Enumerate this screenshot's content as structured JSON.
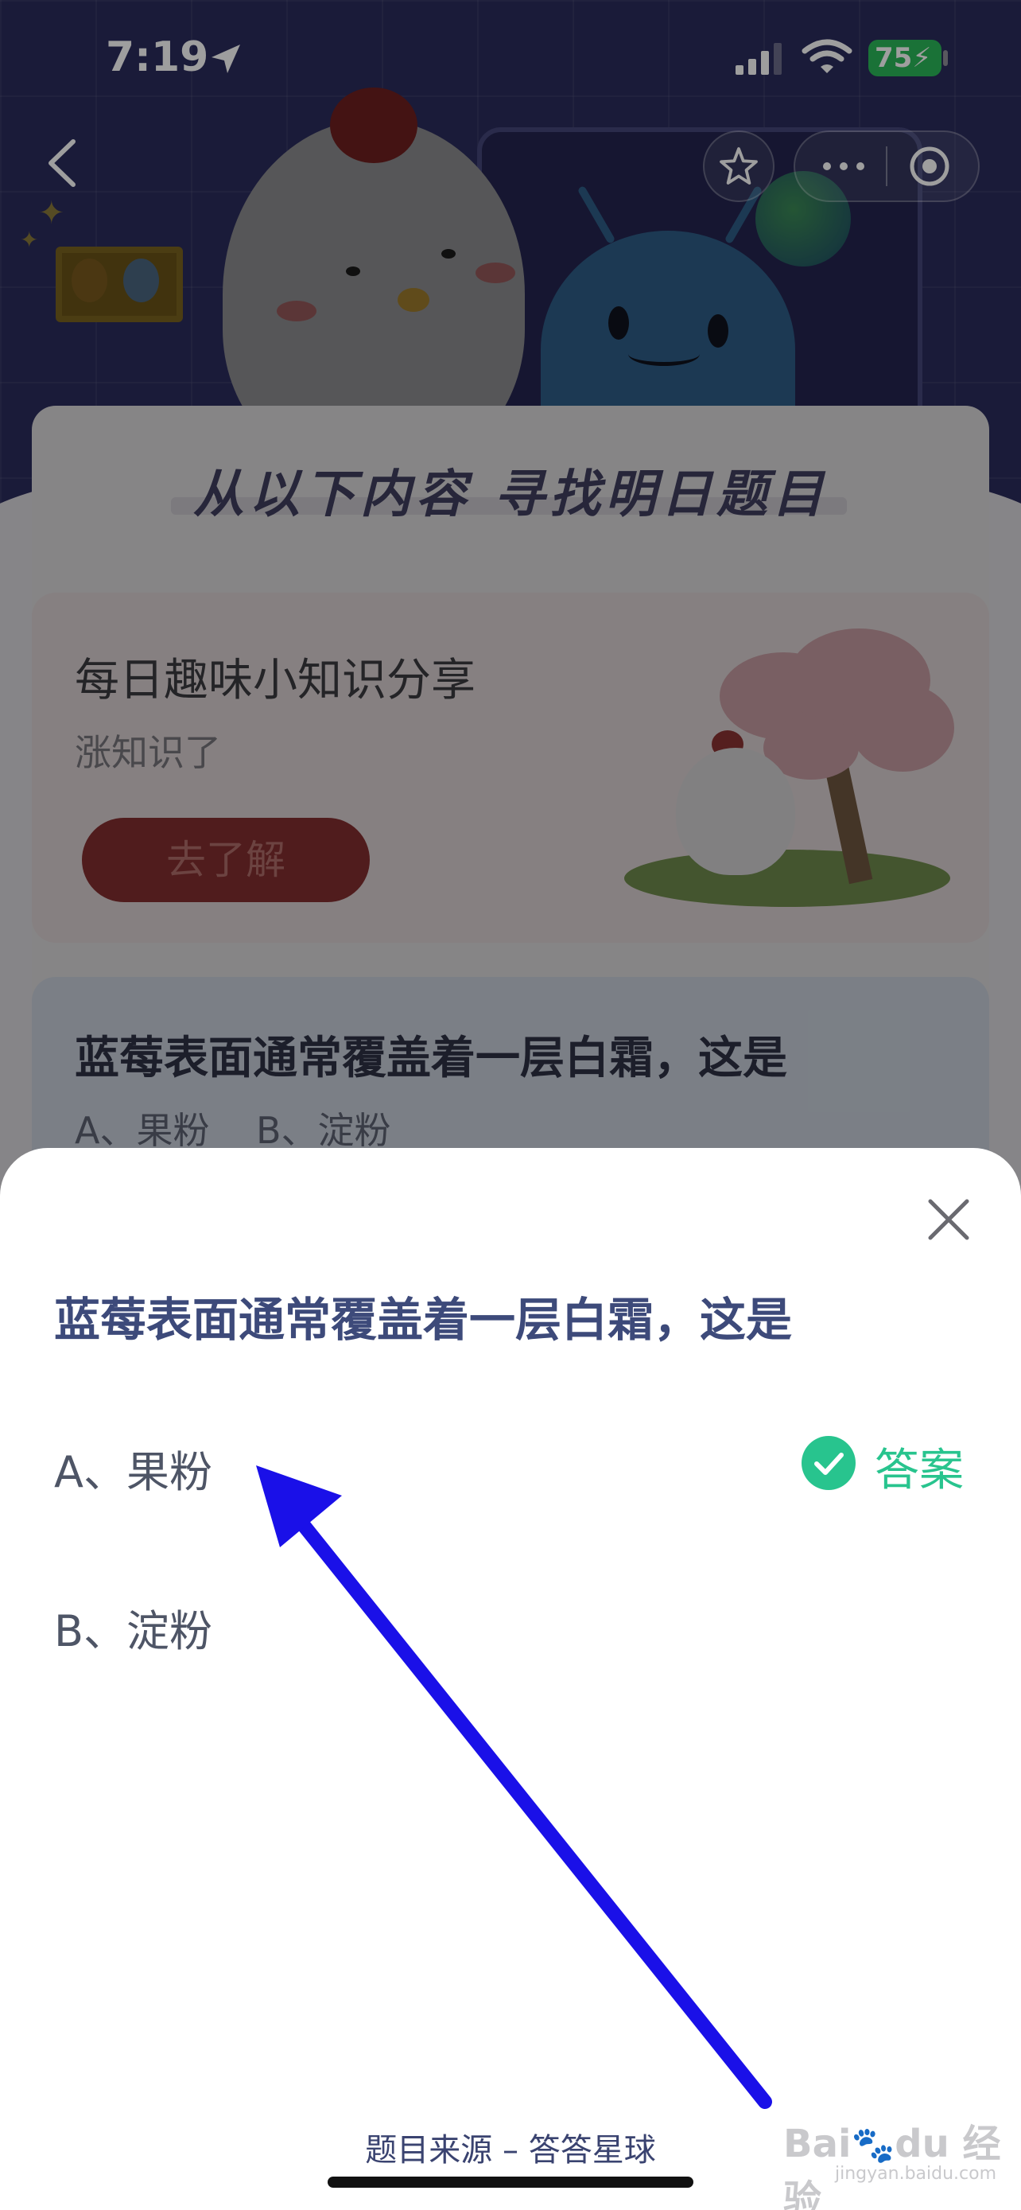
{
  "status_bar": {
    "time": "7:19",
    "battery": "75"
  },
  "background": {
    "banner_title": "从以下内容 寻找明日题目",
    "fun_card": {
      "title": "每日趣味小知识分享",
      "subtitle": "涨知识了",
      "button": "去了解"
    },
    "question_card": {
      "title": "蓝莓表面通常覆盖着一层白霜，这是",
      "options_text": "A、果粉    B、淀粉"
    }
  },
  "sheet": {
    "question": "蓝莓表面通常覆盖着一层白霜，这是",
    "options": [
      {
        "label": "A、果粉",
        "is_answer": true
      },
      {
        "label": "B、淀粉",
        "is_answer": false
      }
    ],
    "answer_badge": "答案",
    "source": "题目来源 – 答答星球"
  },
  "watermark": {
    "main": "Bai du 经验",
    "sub": "jingyan.baidu.com"
  },
  "colors": {
    "accent_green": "#28c48e",
    "question_blue": "#3d4a7a",
    "annotation_arrow": "#1a10e8"
  },
  "icons": [
    "location-arrow-icon",
    "signal-icon",
    "wifi-icon",
    "battery-icon",
    "back-chevron-icon",
    "star-icon",
    "more-icon",
    "target-icon",
    "close-icon",
    "check-icon"
  ]
}
